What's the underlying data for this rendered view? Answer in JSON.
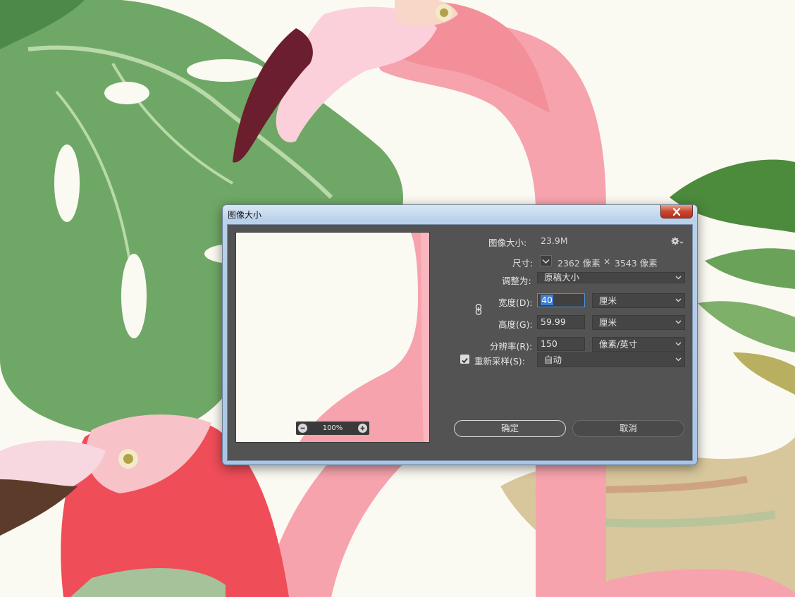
{
  "dialog": {
    "title": "图像大小",
    "image_size_label": "图像大小:",
    "image_size_value": "23.9M",
    "dimensions_label": "尺寸:",
    "dimensions_width": "2362 像素",
    "dimensions_x": "×",
    "dimensions_height": "3543 像素",
    "fit_to_label": "调整为:",
    "fit_to_value": "原稿大小",
    "width_label": "宽度(D):",
    "width_value": "40",
    "width_unit": "厘米",
    "height_label": "高度(G):",
    "height_value": "59.99",
    "height_unit": "厘米",
    "resolution_label": "分辨率(R):",
    "resolution_value": "150",
    "resolution_unit": "像素/英寸",
    "resample_label": "重新采样(S):",
    "resample_checked": true,
    "resample_value": "自动",
    "ok_label": "确定",
    "cancel_label": "取消",
    "zoom_level": "100%"
  },
  "colors": {
    "panel": "#535353",
    "field": "#454545",
    "accent": "#3c7fd5",
    "flamingo": "#f2697a",
    "leaf": "#5a9a54"
  },
  "icons": [
    "gear-icon",
    "link-icon",
    "chevron-down-icon",
    "zoom-out-icon",
    "zoom-in-icon",
    "close-icon",
    "checkbox-icon"
  ]
}
